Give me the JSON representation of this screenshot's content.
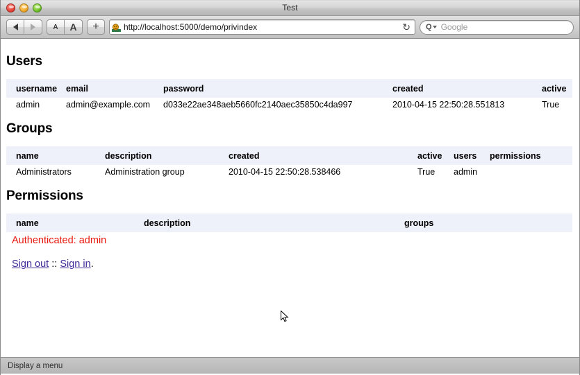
{
  "window": {
    "title": "Test",
    "traffic_lights": [
      "close",
      "minimize",
      "zoom"
    ]
  },
  "toolbar": {
    "back_label": "",
    "forward_label": "",
    "text_smaller_label": "A",
    "text_larger_label": "A",
    "add_label": "+",
    "url": "http://localhost:5000/demo/privindex",
    "reload_label": "↻",
    "search_glyph": "Q",
    "search_placeholder": "Google"
  },
  "sections": {
    "users": {
      "heading": "Users",
      "columns": [
        "username",
        "email",
        "password",
        "created",
        "active"
      ],
      "rows": [
        {
          "username": "admin",
          "email": "admin@example.com",
          "password": "d033e22ae348aeb5660fc2140aec35850c4da997",
          "created": "2010-04-15 22:50:28.551813",
          "active": "True"
        }
      ]
    },
    "groups": {
      "heading": "Groups",
      "columns": [
        "name",
        "description",
        "created",
        "active",
        "users",
        "permissions"
      ],
      "rows": [
        {
          "name": "Administrators",
          "description": "Administration group",
          "created": "2010-04-15 22:50:28.538466",
          "active": "True",
          "users": "admin",
          "permissions": ""
        }
      ]
    },
    "permissions": {
      "heading": "Permissions",
      "columns": [
        "name",
        "description",
        "groups"
      ],
      "rows": []
    }
  },
  "auth": {
    "message": "Authenticated: admin",
    "message_color": "#e8180f",
    "sign_out_label": "Sign out",
    "separator": " :: ",
    "sign_in_label": "Sign in",
    "trailing": "."
  },
  "statusbar": {
    "text": "Display a menu"
  }
}
